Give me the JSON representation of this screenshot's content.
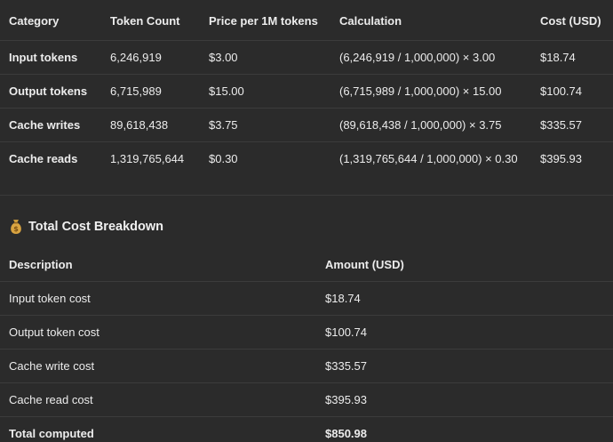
{
  "table1": {
    "headers": [
      "Category",
      "Token Count",
      "Price per 1M tokens",
      "Calculation",
      "Cost (USD)"
    ],
    "rows": [
      [
        "Input tokens",
        "6,246,919",
        "$3.00",
        "(6,246,919 / 1,000,000) × 3.00",
        "$18.74"
      ],
      [
        "Output tokens",
        "6,715,989",
        "$15.00",
        "(6,715,989 / 1,000,000) × 15.00",
        "$100.74"
      ],
      [
        "Cache writes",
        "89,618,438",
        "$3.75",
        "(89,618,438 / 1,000,000) × 3.75",
        "$335.57"
      ],
      [
        "Cache reads",
        "1,319,765,644",
        "$0.30",
        "(1,319,765,644 / 1,000,000) × 0.30",
        "$395.93"
      ]
    ]
  },
  "section": {
    "icon": "money-bag-icon",
    "title": "Total Cost Breakdown"
  },
  "table2": {
    "headers": [
      "Description",
      "Amount (USD)"
    ],
    "rows": [
      [
        "Input token cost",
        "$18.74"
      ],
      [
        "Output token cost",
        "$100.74"
      ],
      [
        "Cache write cost",
        "$335.57"
      ],
      [
        "Cache read cost",
        "$395.93"
      ]
    ],
    "total": [
      "Total computed",
      "$850.98"
    ]
  }
}
